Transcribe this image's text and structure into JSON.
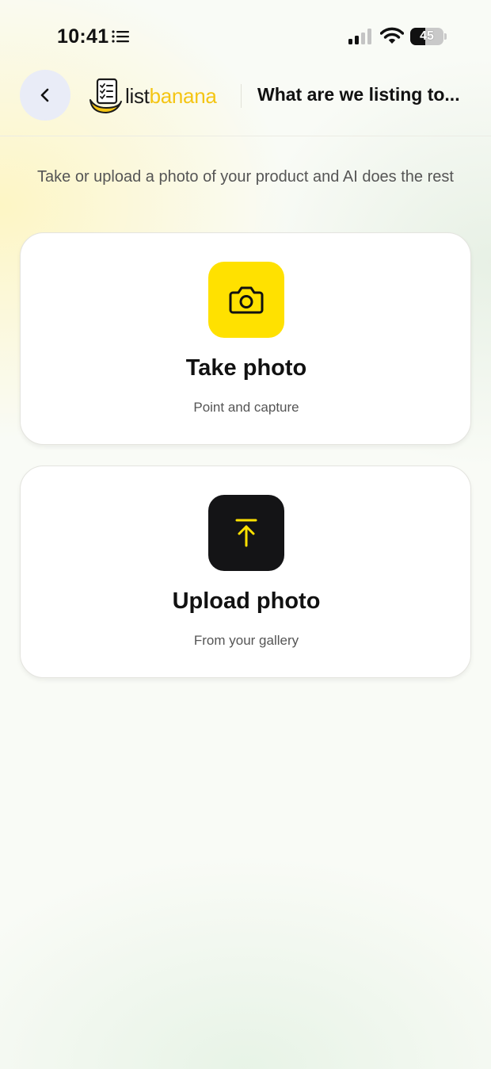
{
  "status_bar": {
    "time": "10:41",
    "battery_level": "45",
    "battery_fraction": 0.45,
    "icons": [
      "list-icon",
      "signal-icon",
      "wifi-icon",
      "battery-icon"
    ]
  },
  "header": {
    "back_icon": "chevron-left-icon",
    "logo": {
      "part1": "list",
      "part2": "banana"
    },
    "title": "What are we listing to..."
  },
  "intro_text": "Take or upload a photo of your product and AI does the rest",
  "options": [
    {
      "title": "Take photo",
      "subtitle": "Point and capture",
      "icon": "camera-icon",
      "icon_bg": "#FFE100"
    },
    {
      "title": "Upload photo",
      "subtitle": "From your gallery",
      "icon": "upload-icon",
      "icon_bg": "#141416"
    }
  ],
  "colors": {
    "brand_yellow": "#F4C514",
    "accent_yellow": "#FFE100",
    "dark": "#141416"
  }
}
